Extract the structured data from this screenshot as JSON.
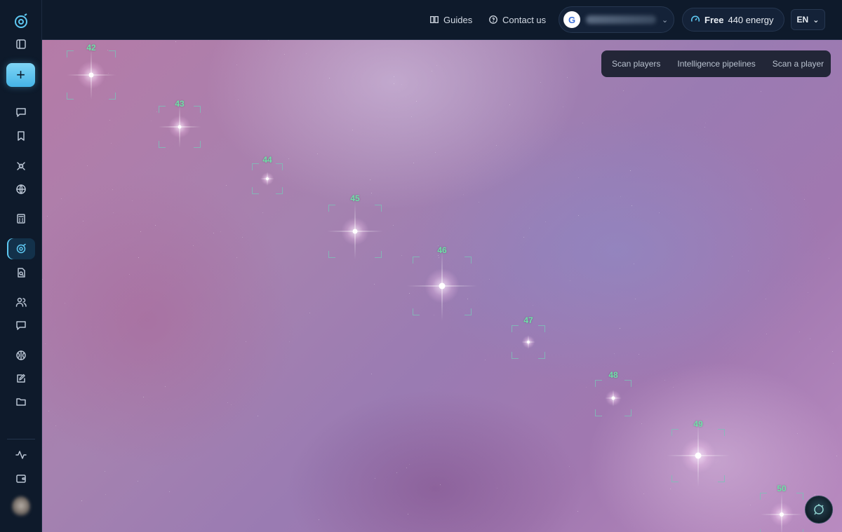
{
  "topbar": {
    "guides_label": "Guides",
    "contact_label": "Contact us",
    "account_initial": "G",
    "plan_label": "Free",
    "energy_label": "440 energy",
    "language": "EN"
  },
  "float_menu": {
    "items": [
      "Scan players",
      "Intelligence pipelines",
      "Scan a player"
    ]
  },
  "stars": [
    {
      "label": "42"
    },
    {
      "label": "43"
    },
    {
      "label": "44"
    },
    {
      "label": "45"
    },
    {
      "label": "46"
    },
    {
      "label": "47"
    },
    {
      "label": "48"
    },
    {
      "label": "49"
    },
    {
      "label": "50"
    }
  ],
  "sidebar": {
    "icons": [
      "sidebar-toggle-icon",
      "chat-icon",
      "bookmark-icon",
      "satellite-icon",
      "globe-icon",
      "calculator-icon",
      "orbit-icon",
      "document-search-icon",
      "users-icon",
      "message-icon",
      "brain-icon",
      "edit-icon",
      "folder-icon",
      "activity-icon",
      "wallet-icon"
    ],
    "active": "orbit-icon"
  },
  "colors": {
    "accent": "#5ec8f2",
    "label_green": "#6fe0a8",
    "panel_bg": "#0e1a2b"
  }
}
